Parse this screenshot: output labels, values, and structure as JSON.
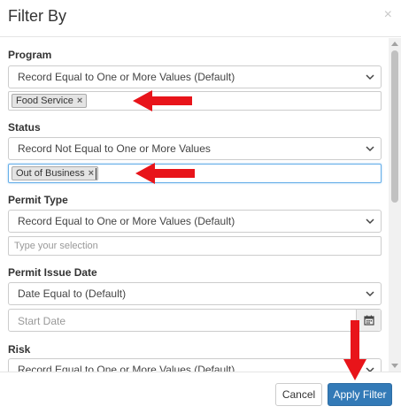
{
  "modal": {
    "title": "Filter By",
    "close_glyph": "×"
  },
  "filters": {
    "program": {
      "label": "Program",
      "operator": "Record Equal to One or More Values (Default)",
      "tags": [
        "Food Service"
      ]
    },
    "status": {
      "label": "Status",
      "operator": "Record Not Equal to One or More Values",
      "tags": [
        "Out of Business"
      ]
    },
    "permit_type": {
      "label": "Permit Type",
      "operator": "Record Equal to One or More Values (Default)",
      "placeholder": "Type your selection"
    },
    "permit_issue_date": {
      "label": "Permit Issue Date",
      "operator": "Date Equal to (Default)",
      "placeholder": "Start Date"
    },
    "risk": {
      "label": "Risk",
      "operator": "Record Equal to One or More Values (Default)"
    }
  },
  "tag_remove_glyph": "×",
  "footer": {
    "cancel_label": "Cancel",
    "apply_label": "Apply Filter"
  },
  "colors": {
    "primary": "#337ab7",
    "annotation_arrow": "#e8141a",
    "focus_border": "#66afe9"
  },
  "icons": {
    "calendar": "calendar-icon",
    "chevron": "chevron-down-icon",
    "close": "close-icon"
  }
}
